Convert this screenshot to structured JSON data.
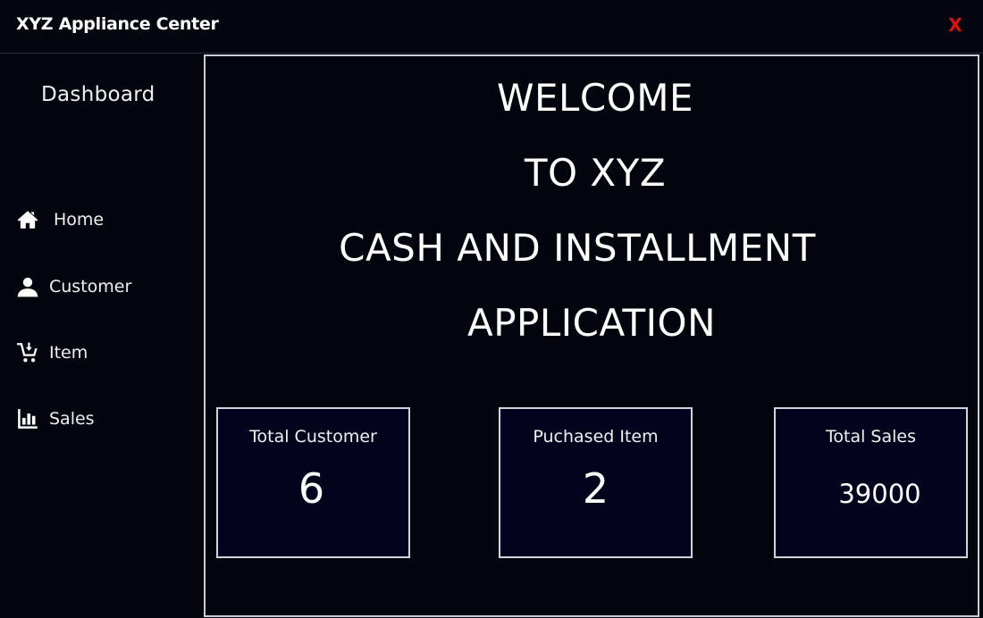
{
  "window": {
    "title": "XYZ Appliance Center",
    "close_label": "X",
    "close_color": "#e01010"
  },
  "sidebar": {
    "title": "Dashboard",
    "items": [
      {
        "label": "Home",
        "icon": "home-icon"
      },
      {
        "label": "Customer",
        "icon": "user-icon"
      },
      {
        "label": "Item",
        "icon": "cart-icon"
      },
      {
        "label": "Sales",
        "icon": "bar-chart-icon"
      }
    ]
  },
  "main": {
    "welcome_lines": [
      "WELCOME",
      "TO XYZ",
      "CASH AND INSTALLMENT",
      "APPLICATION"
    ],
    "stats": [
      {
        "label": "Total Customer",
        "value": "6"
      },
      {
        "label": "Puchased Item",
        "value": "2"
      },
      {
        "label": "Total Sales",
        "value": "39000"
      }
    ]
  },
  "colors": {
    "background": "#04040f",
    "card_background": "#03031d",
    "border": "#c9cdd6",
    "text": "#ffffff"
  }
}
